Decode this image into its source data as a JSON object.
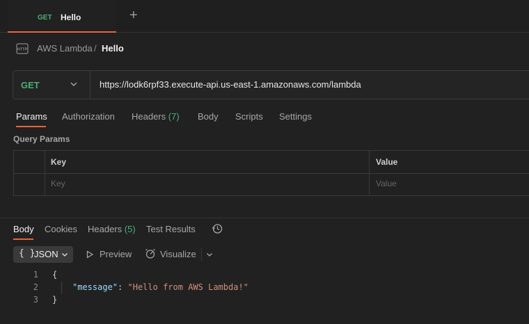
{
  "tabs": [
    {
      "method": "GET",
      "name": "Hello"
    }
  ],
  "new_tab_symbol": "+",
  "breadcrumb": {
    "parent": "AWS Lambda",
    "separator": "/",
    "current": "Hello"
  },
  "request": {
    "method": "GET",
    "url": "https://lodk6rpf33.execute-api.us-east-1.amazonaws.com/lambda"
  },
  "request_tabs": {
    "params": "Params",
    "authorization": "Authorization",
    "headers": "Headers",
    "headers_count": "(7)",
    "body": "Body",
    "scripts": "Scripts",
    "settings": "Settings"
  },
  "query_params": {
    "title": "Query Params",
    "headers": {
      "key": "Key",
      "value": "Value"
    },
    "placeholders": {
      "key": "Key",
      "value": "Value"
    }
  },
  "response_tabs": {
    "body": "Body",
    "cookies": "Cookies",
    "headers": "Headers",
    "headers_count": "(5)",
    "test_results": "Test Results"
  },
  "response_toolbar": {
    "format_icon": "{ }",
    "format": "JSON",
    "preview": "Preview",
    "visualize": "Visualize"
  },
  "response_body": {
    "line_numbers": [
      "1",
      "2",
      "3"
    ],
    "open_brace": "{",
    "key": "\"message\"",
    "colon": ":",
    "value": "\"Hello from AWS Lambda!\"",
    "close_brace": "}"
  },
  "colors": {
    "accent": "#e8643a",
    "method_get": "#4caf78",
    "json_key": "#9cdcfe",
    "json_string": "#ce9178"
  }
}
